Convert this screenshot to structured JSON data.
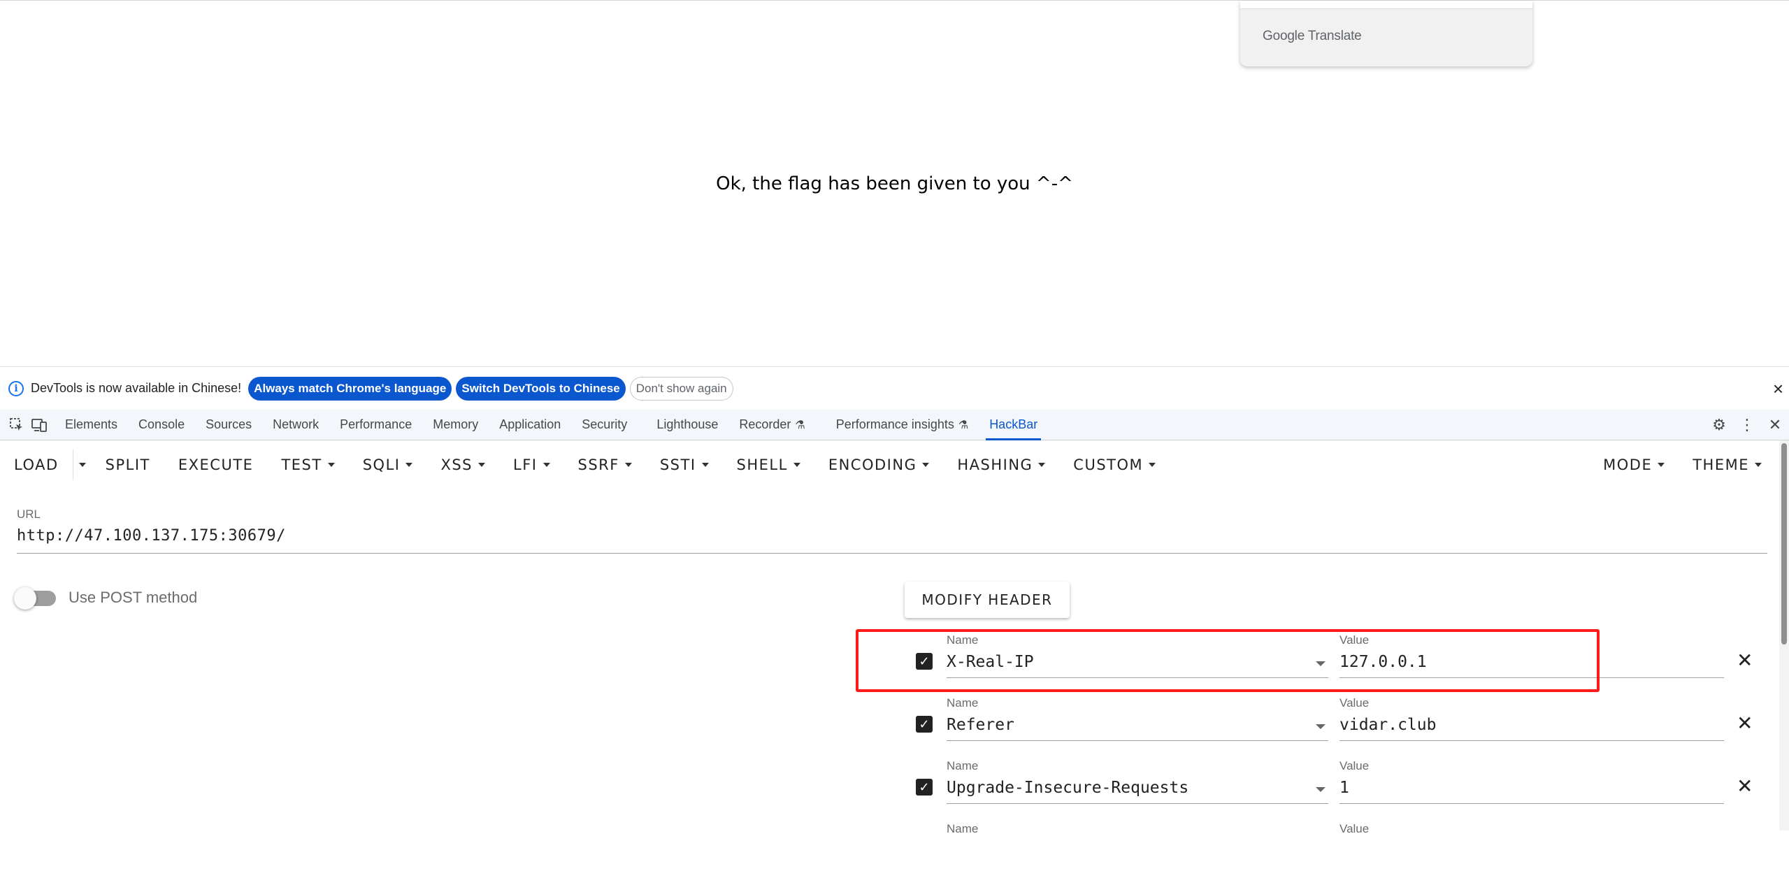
{
  "page": {
    "message": "Ok, the flag has been given to you ^-^"
  },
  "translate_popup": {
    "brand_google": "Google",
    "brand_translate": "Translate"
  },
  "infobar": {
    "text": "DevTools is now available in Chinese!",
    "always_match": "Always match Chrome's language",
    "switch": "Switch DevTools to Chinese",
    "dont_show": "Don't show again",
    "close": "×"
  },
  "devtools_tabs": [
    {
      "label": "Elements"
    },
    {
      "label": "Console"
    },
    {
      "label": "Sources"
    },
    {
      "label": "Network"
    },
    {
      "label": "Performance"
    },
    {
      "label": "Memory"
    },
    {
      "label": "Application"
    },
    {
      "label": "Security"
    },
    {
      "label": "Lighthouse"
    },
    {
      "label": "Recorder"
    },
    {
      "label": "Performance insights"
    },
    {
      "label": "HackBar"
    }
  ],
  "hackbar": {
    "toolbar": {
      "load": "LOAD",
      "split": "SPLIT",
      "execute": "EXECUTE",
      "test": "TEST",
      "sqli": "SQLI",
      "xss": "XSS",
      "lfi": "LFI",
      "ssrf": "SSRF",
      "ssti": "SSTI",
      "shell": "SHELL",
      "encoding": "ENCODING",
      "hashing": "HASHING",
      "custom": "CUSTOM",
      "mode": "MODE",
      "theme": "THEME"
    },
    "url_label": "URL",
    "url_value": "http://47.100.137.175:30679/",
    "post_toggle_label": "Use POST method",
    "modify_header": "MODIFY HEADER",
    "name_label": "Name",
    "value_label": "Value",
    "headers": [
      {
        "name": "X-Real-IP",
        "value": "127.0.0.1",
        "checked": true
      },
      {
        "name": "Referer",
        "value": "vidar.club",
        "checked": true
      },
      {
        "name": "Upgrade-Insecure-Requests",
        "value": "1",
        "checked": true
      }
    ]
  },
  "colors": {
    "accent": "#0b57d0",
    "highlight": "#ff1a1a"
  }
}
